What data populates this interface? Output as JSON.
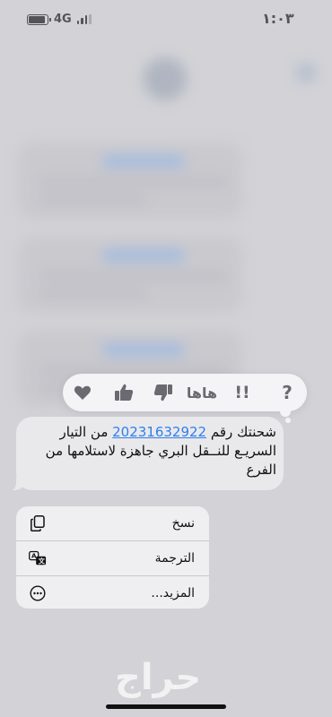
{
  "status_bar": {
    "time": "١:٠٣",
    "network": "4G"
  },
  "tapback": {
    "items": [
      {
        "icon": "question-mark-icon"
      },
      {
        "icon": "exclamation-icon"
      },
      {
        "label": "هاها"
      },
      {
        "icon": "thumbs-down-icon"
      },
      {
        "icon": "thumbs-up-icon"
      },
      {
        "icon": "heart-icon"
      }
    ]
  },
  "message": {
    "prefix": "شحنتك رقم ",
    "number": "20231632922",
    "suffix": " من التيار السريـع للنــقل البري جاهزة لاستلامها من الفرع"
  },
  "menu": {
    "copy": "نسخ",
    "translate": "الترجمة",
    "more": "المزيد..."
  },
  "watermark": "حراج",
  "colors": {
    "link": "#2f7ef0",
    "bubble": "#e9e9eb",
    "menu_bg": "#efeff2"
  }
}
